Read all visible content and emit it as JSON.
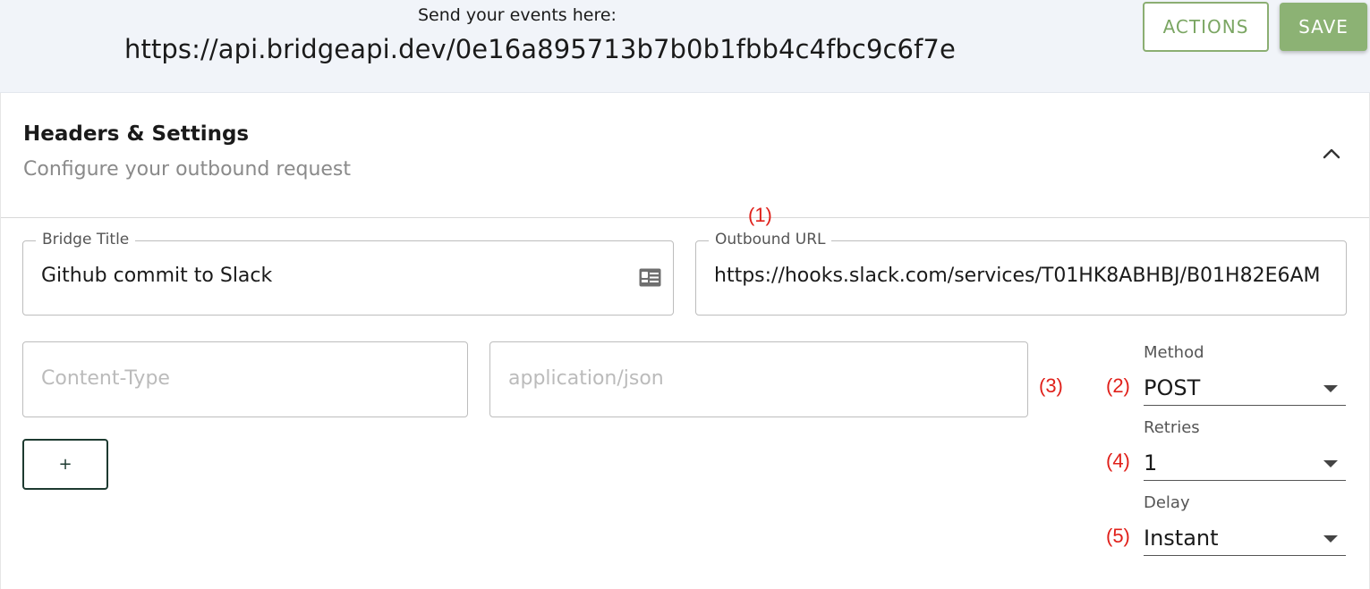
{
  "header": {
    "events_label": "Send your events here:",
    "events_url": "https://api.bridgeapi.dev/0e16a895713b7b0b1fbb4c4fbc9c6f7e",
    "actions_label": "ACTIONS",
    "save_label": "SAVE"
  },
  "section": {
    "title": "Headers & Settings",
    "subtitle": "Configure your outbound request"
  },
  "markers": [
    "(1)",
    "(2)",
    "(3)",
    "(4)",
    "(5)"
  ],
  "fields": {
    "bridge_title": {
      "label": "Bridge Title",
      "value": "Github commit to Slack"
    },
    "outbound_url": {
      "label": "Outbound URL",
      "value": "https://hooks.slack.com/services/T01HK8ABHBJ/B01H82E6AM"
    },
    "header_key": {
      "placeholder": "Content-Type"
    },
    "header_value": {
      "placeholder": "application/json"
    },
    "add_label": "+"
  },
  "selects": {
    "method": {
      "label": "Method",
      "value": "POST"
    },
    "retries": {
      "label": "Retries",
      "value": "1"
    },
    "delay": {
      "label": "Delay",
      "value": "Instant"
    }
  },
  "colors": {
    "accent_green": "#8cb274",
    "marker_red": "#e0201a",
    "dark_green": "#1d3a30",
    "topbar_bg": "#f1f4f9"
  }
}
